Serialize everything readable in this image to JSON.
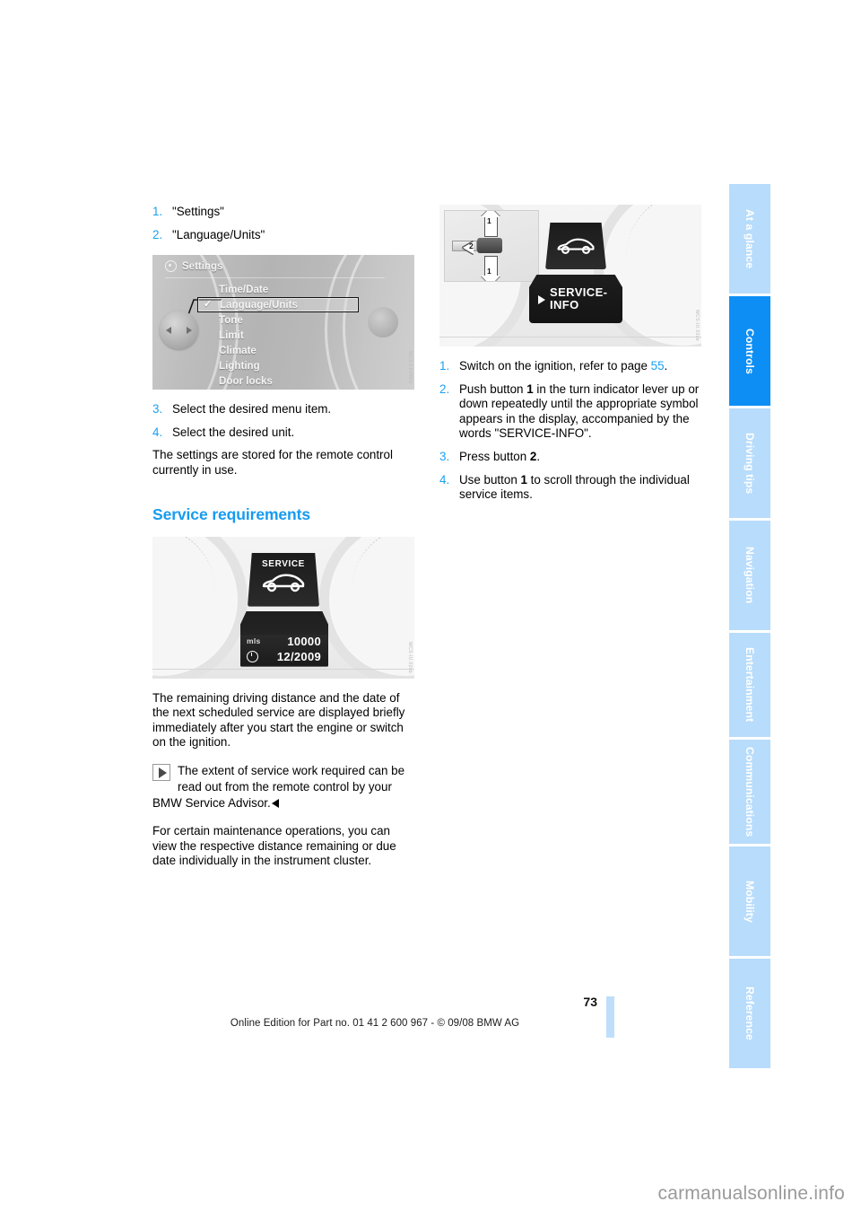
{
  "page": {
    "number": "73",
    "footer_text": "Online Edition for Part no. 01 41 2 600 967  - © 09/08 BMW AG",
    "watermark": "carmanualsonline.info",
    "accent_blue": "#0d8ef5",
    "tab_inactive": "#b8dcfb"
  },
  "sidebar": {
    "tabs": [
      {
        "label": "At a glance",
        "active": false
      },
      {
        "label": "Controls",
        "active": true
      },
      {
        "label": "Driving tips",
        "active": false
      },
      {
        "label": "Navigation",
        "active": false
      },
      {
        "label": "Entertainment",
        "active": false
      },
      {
        "label": "Communications",
        "active": false
      },
      {
        "label": "Mobility",
        "active": false
      },
      {
        "label": "Reference",
        "active": false
      }
    ]
  },
  "left_column": {
    "steps_top": [
      {
        "num": "1.",
        "text": "\"Settings\""
      },
      {
        "num": "2.",
        "text": "\"Language/Units\""
      }
    ],
    "figure_idrive": {
      "menu_title": "Settings",
      "items": [
        {
          "label": "Time/Date",
          "selected": false
        },
        {
          "label": "Language/Units",
          "selected": true
        },
        {
          "label": "Tone",
          "selected": false
        },
        {
          "label": "Limit",
          "selected": false
        },
        {
          "label": "Climate",
          "selected": false
        },
        {
          "label": "Lighting",
          "selected": false
        },
        {
          "label": "Door locks",
          "selected": false
        }
      ],
      "check_glyph": "✓",
      "code": "WCS-L10HDG"
    },
    "steps_bottom": [
      {
        "num": "3.",
        "text": "Select the desired menu item."
      },
      {
        "num": "4.",
        "text": "Select the desired unit."
      }
    ],
    "para_stored": "The settings are stored for the remote control currently in use.",
    "heading": "Service requirements",
    "figure_service": {
      "tile_label": "SERVICE",
      "unit": "mls",
      "distance": "10000",
      "date": "12/2009",
      "code": "WCS-IU.02vb"
    },
    "para_remaining": "The remaining driving distance and the date of the next scheduled service are displayed briefly immediately after you start the engine or switch on the ignition.",
    "note_text": "The extent of service work required can be read out from the remote control by your BMW Service Advisor.",
    "para_certain": "For certain maintenance operations, you can view the respective distance remaining or due date individually in the instrument cluster."
  },
  "right_column": {
    "figure_svcinfo": {
      "inset_labels": {
        "up": "1",
        "down": "1",
        "press": "2"
      },
      "display_text_line1": "SERVICE-",
      "display_text_line2": "INFO",
      "code": "WCS-IU.02xb"
    },
    "steps": [
      {
        "num": "1.",
        "pre": "Switch on the ignition, refer to page ",
        "link": "55",
        "post": "."
      },
      {
        "num": "2.",
        "text_a": "Push button ",
        "bold_a": "1",
        "text_b": " in the turn indicator lever up or down repeatedly until the appropriate symbol appears in the display, accompanied by the words \"SERVICE-INFO\"."
      },
      {
        "num": "3.",
        "text_a": "Press button ",
        "bold_a": "2",
        "text_b": "."
      },
      {
        "num": "4.",
        "text_a": "Use button ",
        "bold_a": "1",
        "text_b": " to scroll through the individual service items."
      }
    ]
  }
}
